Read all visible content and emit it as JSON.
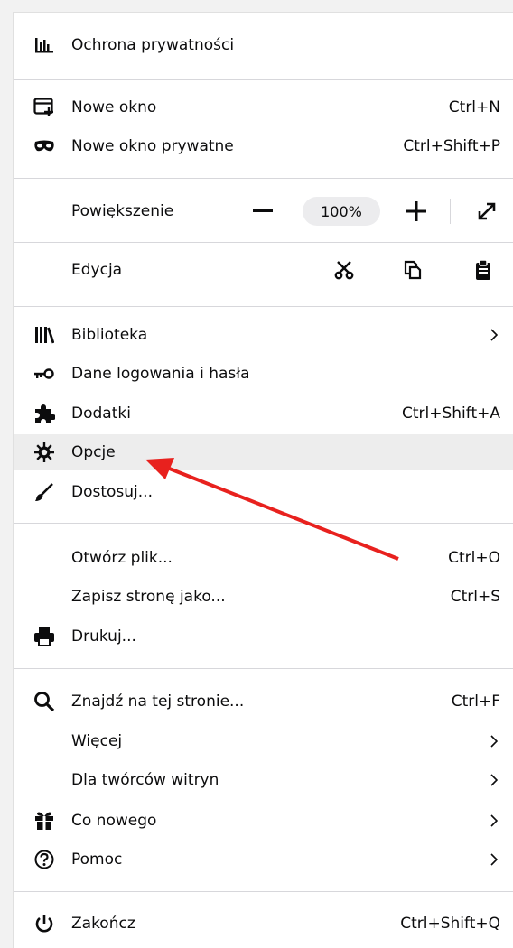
{
  "menu": {
    "privacy": {
      "label": "Ochrona prywatności",
      "icon": "privacy-chart-icon"
    },
    "new_window": {
      "label": "Nowe okno",
      "shortcut": "Ctrl+N",
      "icon": "new-window-icon"
    },
    "private_window": {
      "label": "Nowe okno prywatne",
      "shortcut": "Ctrl+Shift+P",
      "icon": "private-mask-icon"
    },
    "zoom": {
      "label": "Powiększenie",
      "minus": "−",
      "value": "100%",
      "plus": "+",
      "fullscreen_icon": "fullscreen-icon"
    },
    "edit": {
      "label": "Edycja",
      "cut_icon": "cut-icon",
      "copy_icon": "copy-icon",
      "paste_icon": "paste-icon"
    },
    "library": {
      "label": "Biblioteka",
      "icon": "library-icon"
    },
    "logins": {
      "label": "Dane logowania i hasła",
      "icon": "key-icon"
    },
    "addons": {
      "label": "Dodatki",
      "shortcut": "Ctrl+Shift+A",
      "icon": "puzzle-icon"
    },
    "options": {
      "label": "Opcje",
      "icon": "gear-icon"
    },
    "customize": {
      "label": "Dostosuj...",
      "icon": "brush-icon"
    },
    "open_file": {
      "label": "Otwórz plik...",
      "shortcut": "Ctrl+O"
    },
    "save_page": {
      "label": "Zapisz stronę jako...",
      "shortcut": "Ctrl+S"
    },
    "print": {
      "label": "Drukuj...",
      "icon": "printer-icon"
    },
    "find": {
      "label": "Znajdź na tej stronie...",
      "shortcut": "Ctrl+F",
      "icon": "search-icon"
    },
    "more": {
      "label": "Więcej"
    },
    "web_dev": {
      "label": "Dla twórców witryn"
    },
    "whats_new": {
      "label": "Co nowego",
      "icon": "gift-icon"
    },
    "help": {
      "label": "Pomoc",
      "icon": "help-icon"
    },
    "quit": {
      "label": "Zakończ",
      "shortcut": "Ctrl+Shift+Q",
      "icon": "power-icon"
    }
  },
  "colors": {
    "annotation_arrow": "#e8211e",
    "hover_bg": "#ededed",
    "separator": "#d7d7db"
  }
}
